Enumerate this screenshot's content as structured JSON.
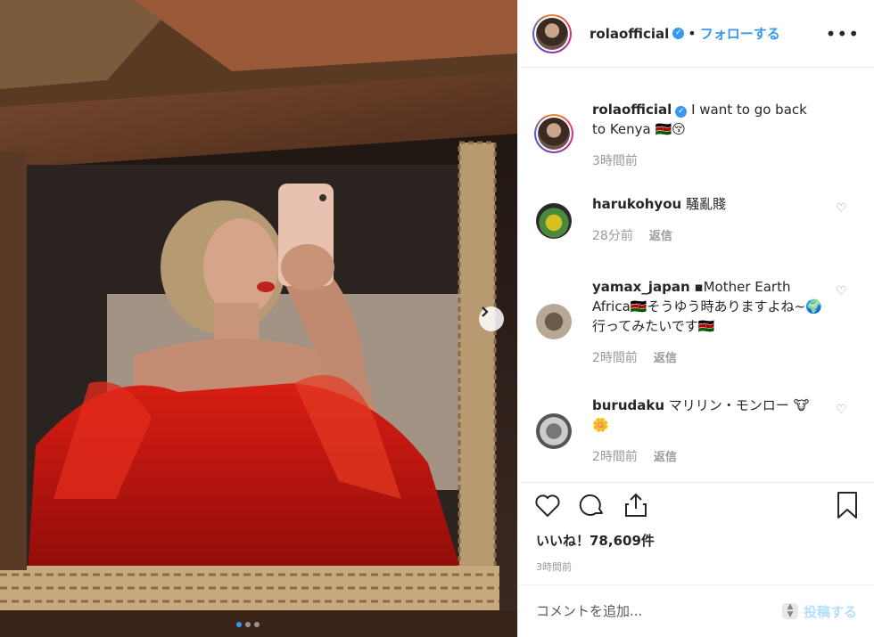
{
  "post": {
    "username": "rolaofficial",
    "follow_label": "フォローする",
    "separator": "•",
    "more_label": "•••"
  },
  "caption": {
    "username": "rolaofficial",
    "text": "I want to go back to Kenya 🇰🇪😚",
    "time": "3時間前"
  },
  "comments": [
    {
      "user": "harukohyou",
      "text": "騒亂賤",
      "time": "28分前",
      "reply": "返信"
    },
    {
      "user": "yamax_japan",
      "text": "▪Mother Earth Africa🇰🇪そうゆう時ありますよね~🌍行ってみたいです🇰🇪",
      "time": "2時間前",
      "reply": "返信"
    },
    {
      "user": "burudaku",
      "text": "マリリン・モンロー 🐮🌼",
      "time": "2時間前",
      "reply": "返信"
    }
  ],
  "likes_text": "いいね！78,609件",
  "post_time": "3時間前",
  "add_comment": {
    "placeholder": "コメントを追加...",
    "post_label": "投稿する"
  },
  "colors": {
    "accent": "#3897f0",
    "dress": "#c4120f"
  },
  "icons": [
    "next-arrow-icon",
    "verified-badge-icon",
    "heart-icon",
    "comment-icon",
    "share-icon",
    "bookmark-icon"
  ]
}
